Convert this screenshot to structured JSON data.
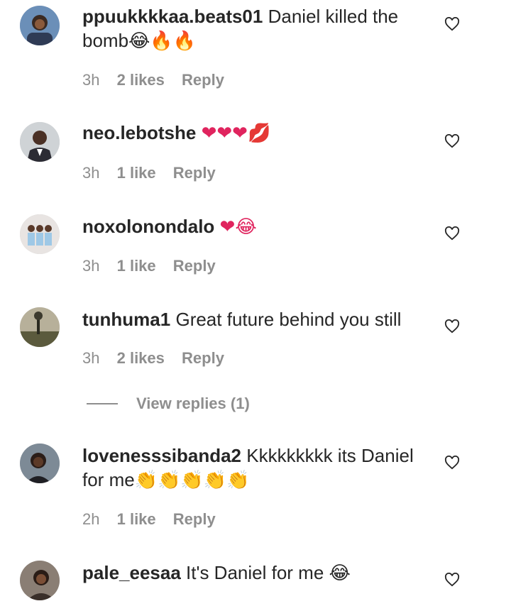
{
  "comments": [
    {
      "username": "ppuukkkkaa.beats01",
      "text": "Daniel killed the bomb",
      "emoji": "😂🔥🔥",
      "time": "3h",
      "likes": "2 likes",
      "reply": "Reply"
    },
    {
      "username": "neo.lebotshe",
      "text": "",
      "emoji": "❤❤❤💋",
      "time": "3h",
      "likes": "1 like",
      "reply": "Reply"
    },
    {
      "username": "noxolonondalo",
      "text": "",
      "emoji": "❤😂",
      "time": "3h",
      "likes": "1 like",
      "reply": "Reply"
    },
    {
      "username": "tunhuma1",
      "text": "Great future behind you still",
      "emoji": "",
      "time": "3h",
      "likes": "2 likes",
      "reply": "Reply"
    },
    {
      "username": "lovenesssibanda2",
      "text": "Kkkkkkkkk its Daniel for me",
      "emoji": "👏👏👏👏👏",
      "time": "2h",
      "likes": "1 like",
      "reply": "Reply"
    },
    {
      "username": "pale_eesaa",
      "text": "It's Daniel for me",
      "emoji": "😂",
      "time": "",
      "likes": "",
      "reply": ""
    }
  ],
  "view_replies": "View replies (1)",
  "colors": {
    "text": "#262626",
    "muted": "#8e8e8e",
    "background": "#ffffff"
  },
  "icons": [
    "avatar",
    "heart-icon"
  ]
}
